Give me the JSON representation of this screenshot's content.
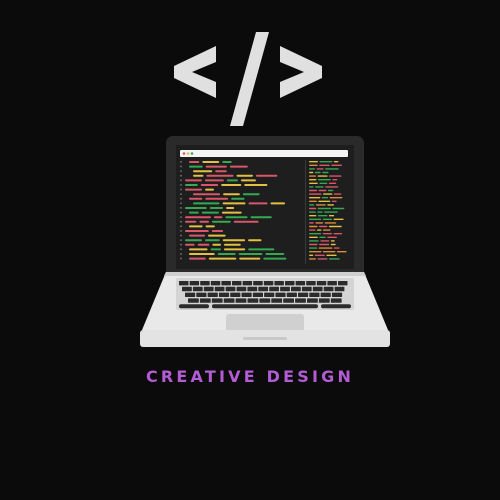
{
  "logo": {
    "symbol_icon": "code-brackets-icon",
    "device_icon": "laptop-icon",
    "tagline": "CREATIVE DESIGN"
  },
  "colors": {
    "background": "#0b0b0b",
    "symbol": "#e0e0e0",
    "tagline": "#b45bd6",
    "laptop_lid": "#2a2a2a",
    "screen": "#1e1e1e",
    "laptop_body": "#e9e9e9",
    "keys": "#2b2b2b",
    "code_red": "#d8576b",
    "code_yellow": "#e2c044",
    "code_green": "#35a852",
    "code_orange": "#e08a3c"
  }
}
